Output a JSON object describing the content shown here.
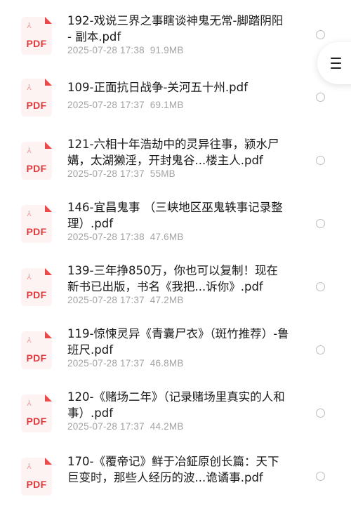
{
  "files": [
    {
      "icon_label": "PDF",
      "name": "192-戏说三界之事瞎谈神鬼无常-脚踏阴阳 - 副本.pdf",
      "date": "2025-07-28 17:38",
      "size": "91.9MB"
    },
    {
      "icon_label": "PDF",
      "name": "109-正面抗日战争-关河五十州.pdf",
      "date": "2025-07-28 17:37",
      "size": "69.1MB"
    },
    {
      "icon_label": "PDF",
      "name": "121-六相十年浩劫中的灵异往事，颍水尸媾，太湖獭淫，开封鬼谷...楼主人.pdf",
      "date": "2025-07-28 17:37",
      "size": "55MB"
    },
    {
      "icon_label": "PDF",
      "name": "146-宜昌鬼事 （三峡地区巫鬼轶事记录整理）.pdf",
      "date": "2025-07-28 17:38",
      "size": "47.6MB"
    },
    {
      "icon_label": "PDF",
      "name": "139-三年挣850万，你也可以复制！现在新书已出版，书名《我把...诉你》.pdf",
      "date": "2025-07-28 17:37",
      "size": "47.2MB"
    },
    {
      "icon_label": "PDF",
      "name": "119-惊悚灵异《青囊尸衣》（斑竹推荐）-鲁班尺.pdf",
      "date": "2025-07-28 17:37",
      "size": "46.8MB"
    },
    {
      "icon_label": "PDF",
      "name": "120-《赌场二年》（记录赌场里真实的人和事）.pdf",
      "date": "2025-07-28 17:37",
      "size": "44.2MB"
    },
    {
      "icon_label": "PDF",
      "name": "170-《覆帝记》鲜于冶鉦原创长篇：天下巨变时，那些人经历的波...诡谲事.pdf",
      "date": "",
      "size": ""
    }
  ],
  "colors": {
    "pdf_red": "#e0393c",
    "meta_gray": "#a3a3a3"
  },
  "icons": {
    "file": "pdf-file-icon",
    "menu": "hamburger-menu-icon",
    "select": "radio-circle-icon"
  }
}
